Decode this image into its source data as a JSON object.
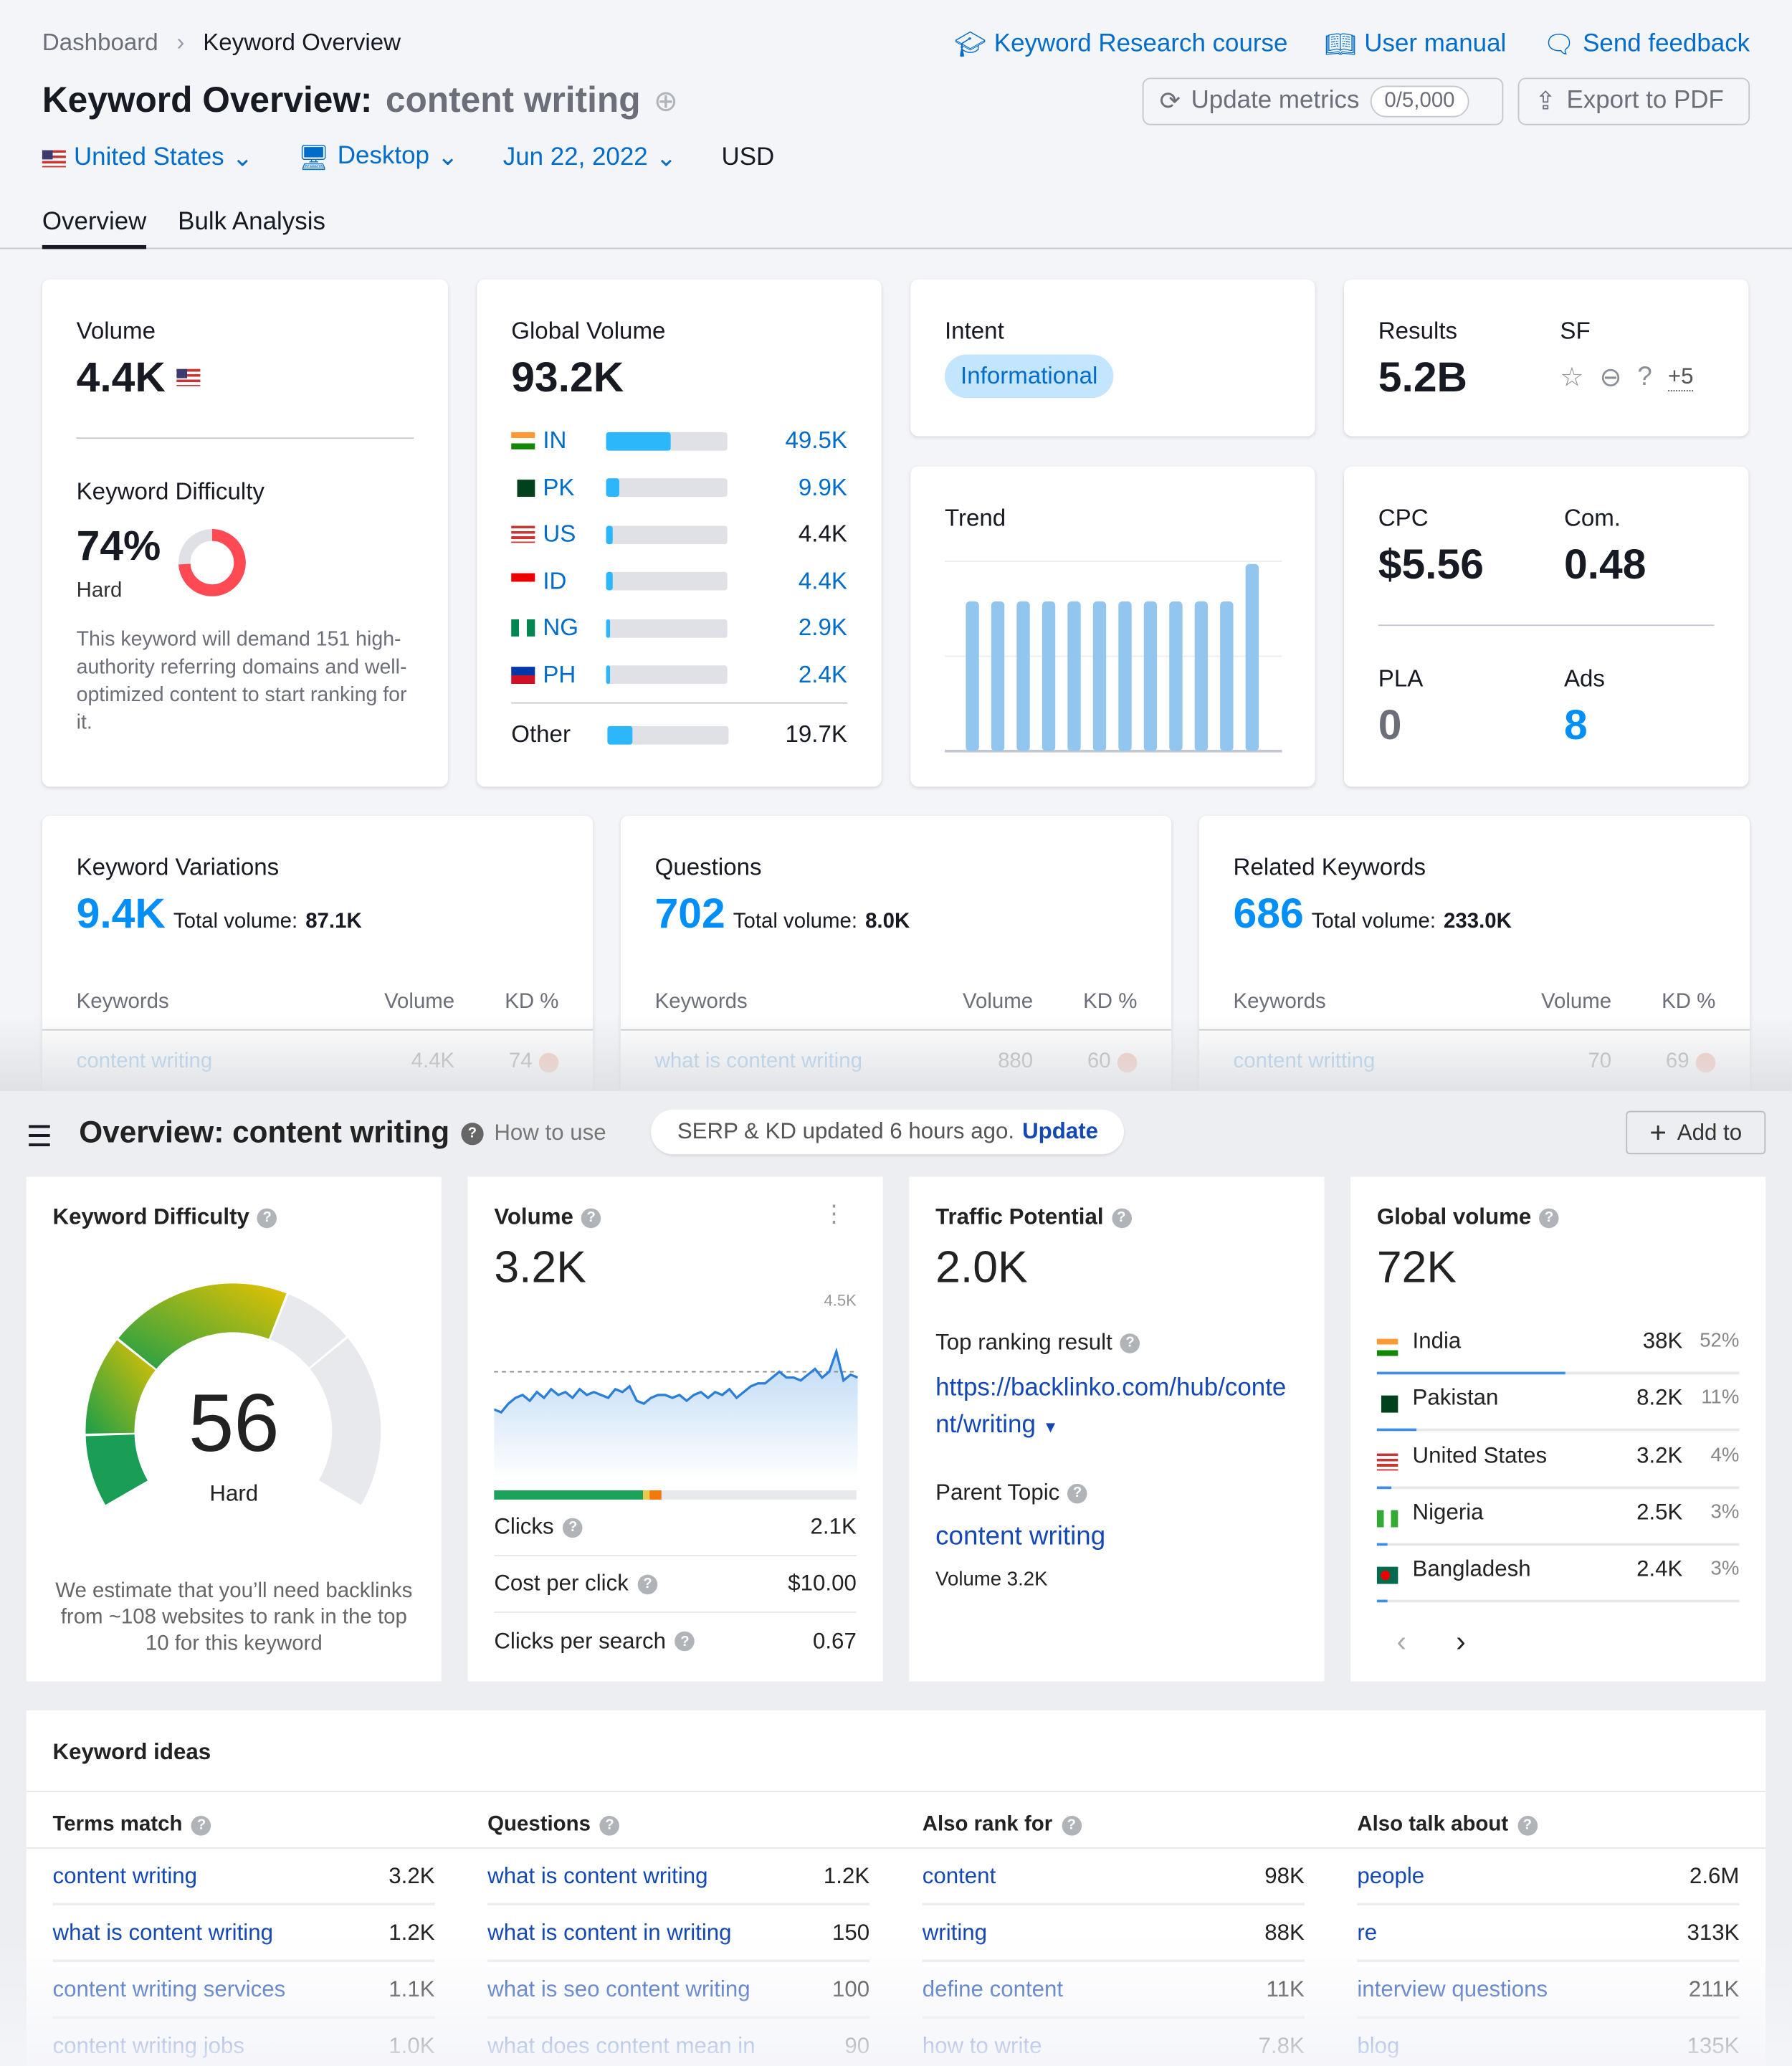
{
  "breadcrumb": {
    "items": [
      "Dashboard",
      "Keyword Overview"
    ]
  },
  "header": {
    "title_prefix": "Keyword Overview:",
    "keyword": "content writing",
    "links": {
      "course": "Keyword Research course",
      "manual": "User manual",
      "feedback": "Send feedback"
    },
    "update_metrics": "Update metrics",
    "update_count": "0/5,000",
    "export": "Export to PDF"
  },
  "filters": {
    "country": "United States",
    "device": "Desktop",
    "date": "Jun 22, 2022",
    "currency": "USD"
  },
  "tabs": [
    "Overview",
    "Bulk Analysis"
  ],
  "volume": {
    "label": "Volume",
    "value": "4.4K"
  },
  "kd": {
    "label": "Keyword Difficulty",
    "value": "74%",
    "level": "Hard",
    "percent": 74,
    "desc": "This keyword will demand 151 high-authority referring domains and well-optimized content to start ranking for it."
  },
  "global_volume": {
    "label": "Global Volume",
    "value": "93.2K",
    "countries": [
      {
        "code": "IN",
        "value": "49.5K",
        "share": 0.53
      },
      {
        "code": "PK",
        "value": "9.9K",
        "share": 0.11
      },
      {
        "code": "US",
        "value": "4.4K",
        "share": 0.05
      },
      {
        "code": "ID",
        "value": "4.4K",
        "share": 0.05
      },
      {
        "code": "NG",
        "value": "2.9K",
        "share": 0.03
      },
      {
        "code": "PH",
        "value": "2.4K",
        "share": 0.03
      }
    ],
    "other": {
      "label": "Other",
      "value": "19.7K",
      "share": 0.21
    }
  },
  "intent": {
    "label": "Intent",
    "value": "Informational"
  },
  "results": {
    "label": "Results",
    "value": "5.2B",
    "sf_label": "SF",
    "sf_more": "+5"
  },
  "trend": {
    "label": "Trend",
    "values": [
      0.8,
      0.8,
      0.8,
      0.8,
      0.8,
      0.8,
      0.8,
      0.8,
      0.8,
      0.8,
      0.8,
      1.0
    ]
  },
  "cpc": {
    "cpc_label": "CPC",
    "cpc": "$5.56",
    "com_label": "Com.",
    "com": "0.48",
    "pla_label": "PLA",
    "pla": "0",
    "ads_label": "Ads",
    "ads": "8"
  },
  "summary_cards": [
    {
      "title": "Keyword Variations",
      "count": "9.4K",
      "total_label": "Total volume:",
      "total": "87.1K",
      "row": {
        "kw": "content writing",
        "vol": "4.4K",
        "kd": "74"
      }
    },
    {
      "title": "Questions",
      "count": "702",
      "total_label": "Total volume:",
      "total": "8.0K",
      "row": {
        "kw": "what is content writing",
        "vol": "880",
        "kd": "60"
      }
    },
    {
      "title": "Related Keywords",
      "count": "686",
      "total_label": "Total volume:",
      "total": "233.0K",
      "row": {
        "kw": "content writting",
        "vol": "70",
        "kd": "69"
      }
    }
  ],
  "table_headers": {
    "kw": "Keywords",
    "vol": "Volume",
    "kd": "KD %"
  },
  "ahrefs": {
    "title": "Overview: content writing",
    "how_to": "How to use",
    "status": "SERP & KD updated 6 hours ago.",
    "update": "Update",
    "add_to": "Add to",
    "kd": {
      "title": "Keyword Difficulty",
      "value": "56",
      "level": "Hard",
      "desc": "We estimate that you’ll need backlinks from ~108 websites to rank in the top 10 for this keyword"
    },
    "volume": {
      "title": "Volume",
      "value": "3.2K",
      "max_label": "4.5K",
      "history": [
        2.2,
        2.1,
        2.4,
        2.6,
        2.7,
        2.5,
        2.8,
        2.6,
        2.9,
        2.7,
        2.8,
        2.6,
        2.9,
        2.7,
        2.8,
        2.7,
        2.6,
        2.9,
        2.8,
        3.0,
        2.5,
        2.4,
        2.6,
        2.7,
        2.7,
        2.6,
        2.7,
        2.5,
        2.7,
        2.8,
        2.6,
        2.8,
        2.7,
        2.9,
        2.6,
        2.8,
        3.0,
        3.1,
        3.1,
        3.3,
        3.5,
        3.3,
        3.3,
        3.2,
        3.4,
        3.6,
        3.3,
        3.5,
        4.2,
        3.2,
        3.4,
        3.3
      ],
      "avg": 3.5,
      "clicks_split": {
        "organic": 0.41,
        "paid": 0.02,
        "other": 0.03
      },
      "metrics": [
        {
          "label": "Clicks",
          "value": "2.1K"
        },
        {
          "label": "Cost per click",
          "value": "$10.00"
        },
        {
          "label": "Clicks per search",
          "value": "0.67"
        }
      ]
    },
    "traffic": {
      "title": "Traffic Potential",
      "value": "2.0K",
      "top_label": "Top ranking result",
      "top_url": "https://backlinko.com/hub/content/writing",
      "parent_label": "Parent Topic",
      "parent": "content writing",
      "parent_volume": "Volume 3.2K"
    },
    "global": {
      "title": "Global volume",
      "value": "72K",
      "countries": [
        {
          "name": "India",
          "value": "38K",
          "pct": "52%",
          "share": 0.52
        },
        {
          "name": "Pakistan",
          "value": "8.2K",
          "pct": "11%",
          "share": 0.11
        },
        {
          "name": "United States",
          "value": "3.2K",
          "pct": "4%",
          "share": 0.04
        },
        {
          "name": "Nigeria",
          "value": "2.5K",
          "pct": "3%",
          "share": 0.03
        },
        {
          "name": "Bangladesh",
          "value": "2.4K",
          "pct": "3%",
          "share": 0.03
        }
      ]
    },
    "ideas": {
      "title": "Keyword ideas",
      "columns": [
        {
          "title": "Terms match",
          "rows": [
            [
              "content writing",
              "3.2K"
            ],
            [
              "what is content writing",
              "1.2K"
            ],
            [
              "content writing services",
              "1.1K"
            ],
            [
              "content writing jobs",
              "1.0K"
            ]
          ]
        },
        {
          "title": "Questions",
          "rows": [
            [
              "what is content writing",
              "1.2K"
            ],
            [
              "what is content in writing",
              "150"
            ],
            [
              "what is seo content writing",
              "100"
            ],
            [
              "what does content mean in",
              "90"
            ]
          ]
        },
        {
          "title": "Also rank for",
          "rows": [
            [
              "content",
              "98K"
            ],
            [
              "writing",
              "88K"
            ],
            [
              "define content",
              "11K"
            ],
            [
              "how to write",
              "7.8K"
            ]
          ]
        },
        {
          "title": "Also talk about",
          "rows": [
            [
              "people",
              "2.6M"
            ],
            [
              "re",
              "313K"
            ],
            [
              "interview questions",
              "211K"
            ],
            [
              "blog",
              "135K"
            ]
          ]
        }
      ]
    }
  },
  "colors": {
    "accent": "#006dca",
    "link_dark": "#1448b4",
    "bar": "#2bb7f9",
    "trend": "#92c6ee",
    "kd_red": "#ff4953",
    "intent_bg": "#c4e5fe"
  }
}
